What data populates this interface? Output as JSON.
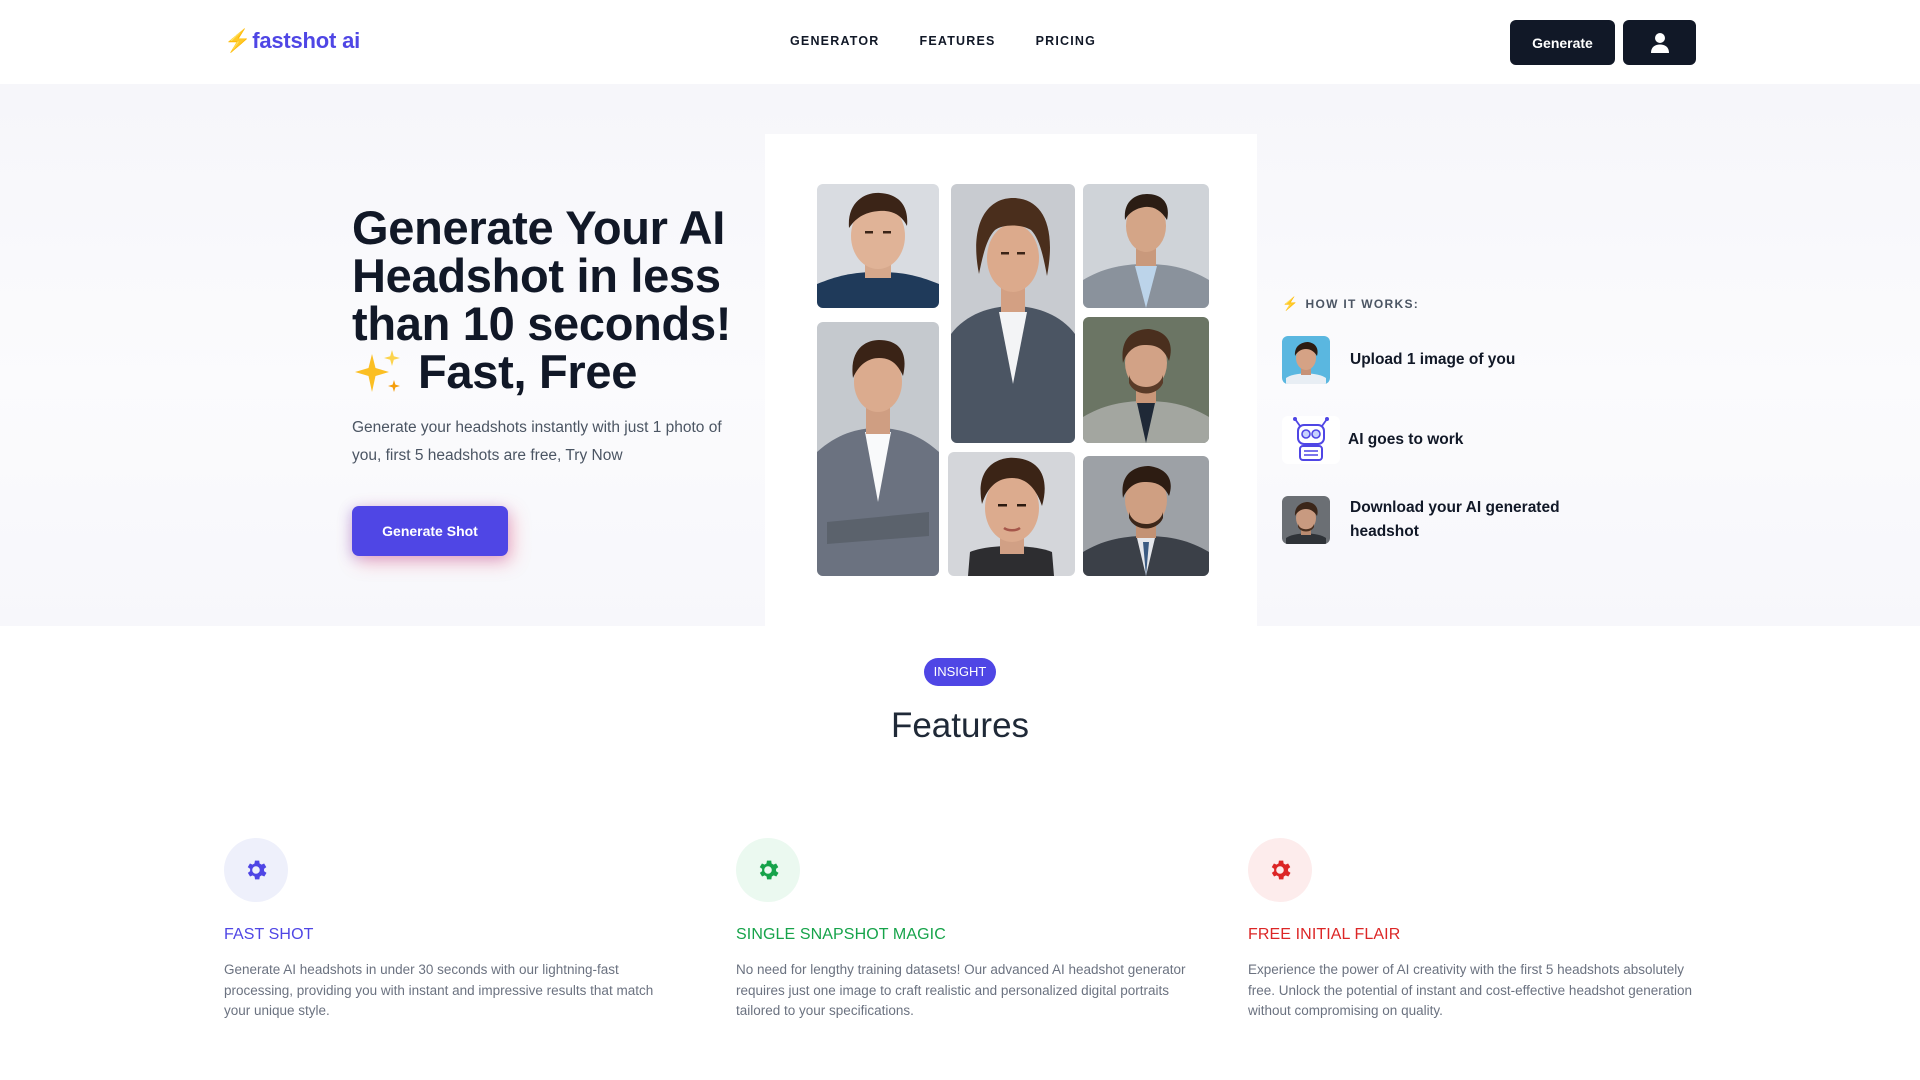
{
  "header": {
    "logo_bolt": "⚡",
    "logo_text": "fastshot ai",
    "nav": [
      "GENERATOR",
      "FEATURES",
      "PRICING"
    ],
    "generate_label": "Generate",
    "user_icon": "user-icon"
  },
  "hero": {
    "title_line1": "Generate Your AI Headshot in less than 10 seconds!",
    "title_line2": "Fast, Free",
    "subtitle": "Generate your headshots instantly with just 1 photo of you, first 5 headshots are free, Try Now",
    "cta_label": "Generate Shot"
  },
  "how_it_works": {
    "heading": "HOW IT WORKS:",
    "steps": [
      {
        "label": "Upload 1 image of you",
        "icon": "photo-thumbnail"
      },
      {
        "label": "AI goes to work",
        "icon": "robot-icon"
      },
      {
        "label": "Download your AI generated headshot",
        "icon": "headshot-thumbnail"
      }
    ]
  },
  "features": {
    "badge": "INSIGHT",
    "title": "Features",
    "items": [
      {
        "title": "FAST SHOT",
        "description": "Generate AI headshots in under 30 seconds with our lightning-fast processing, providing you with instant and impressive results that match your unique style.",
        "color": "#4f46e5",
        "bg": "#eef0fb",
        "icon": "gear-icon"
      },
      {
        "title": "SINGLE SNAPSHOT MAGIC",
        "description": "No need for lengthy training datasets! Our advanced AI headshot generator requires just one image to craft realistic and personalized digital portraits tailored to your specifications.",
        "color": "#16a34a",
        "bg": "#ebf9f0",
        "icon": "gear-icon"
      },
      {
        "title": "FREE INITIAL FLAIR",
        "description": "Experience the power of AI creativity with the first 5 headshots absolutely free. Unlock the potential of instant and cost-effective headshot generation without compromising on quality.",
        "color": "#dc2626",
        "bg": "#fdecec",
        "icon": "gear-icon"
      }
    ]
  }
}
